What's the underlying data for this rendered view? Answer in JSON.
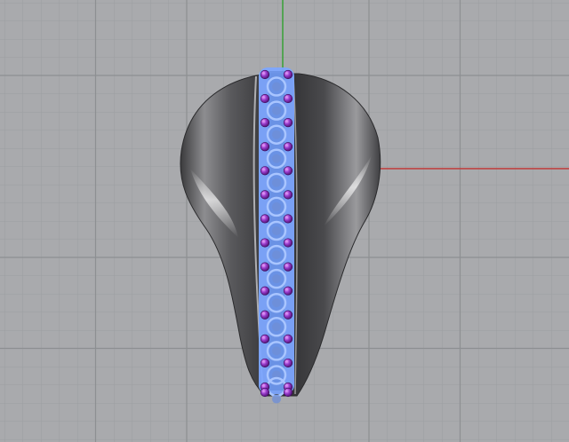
{
  "viewport": {
    "view_type": "perspective-3d",
    "background_color": "#a9aaad",
    "grid_minor_color": "#9c9ea1",
    "grid_major_color": "#8b8d90",
    "grid_visible": true
  },
  "axes": {
    "x_axis": {
      "color": "#c03a3a",
      "visible": true
    },
    "y_axis": {
      "color": "#2fa02f",
      "visible": true
    }
  },
  "model": {
    "description_icon": "ring-model-icon",
    "body_color": "#6a6a6c",
    "body_highlight": "#eeeeee",
    "selection_color": "#7da7ff",
    "gem_color": "#7a28a6",
    "gem_highlight": "#d98ef0",
    "stone_rows": 14
  }
}
